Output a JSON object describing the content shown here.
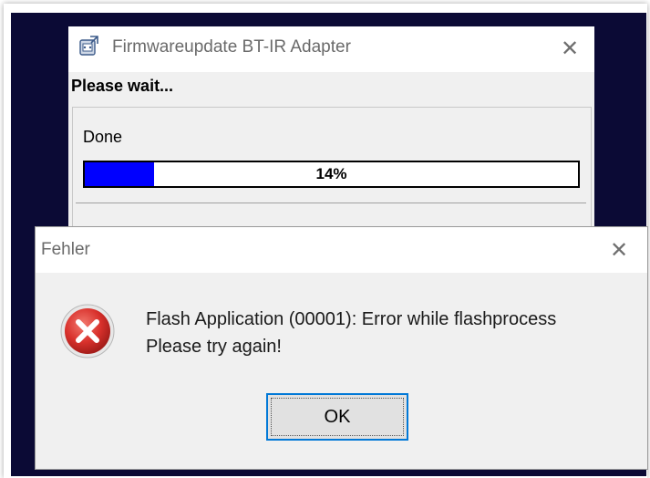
{
  "back_window": {
    "title": "Firmwareupdate BT-IR Adapter",
    "close_glyph": "✕",
    "heading": "Please wait...",
    "status": "Done",
    "progress": {
      "value": 0.14,
      "label": "14%",
      "fill_color": "#0000ff"
    },
    "icon": "application-icon"
  },
  "error_dialog": {
    "title": "Fehler",
    "close_glyph": "✕",
    "icon": "error-icon",
    "message_line1": "Flash Application (00001): Error while flashprocess",
    "message_line2": "Please try again!",
    "ok_label": "OK",
    "accent_color": "#0078d7",
    "error_color": "#d9312c"
  },
  "desktop_color": "#0b0a35"
}
